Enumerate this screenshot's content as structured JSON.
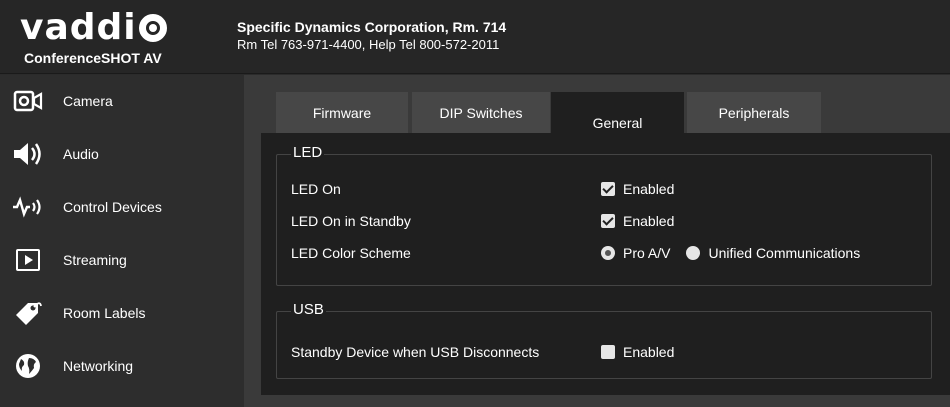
{
  "header": {
    "brand": "vaddi",
    "brand_o": "o",
    "product": "ConferenceSHOT AV",
    "org_name": "Specific Dynamics Corporation, Rm. 714",
    "org_tel": "Rm Tel 763-971-4400, Help Tel 800-572-2011"
  },
  "sidebar": {
    "items": [
      {
        "label": "Camera",
        "icon": "camera-icon"
      },
      {
        "label": "Audio",
        "icon": "speaker-icon"
      },
      {
        "label": "Control Devices",
        "icon": "control-devices-icon"
      },
      {
        "label": "Streaming",
        "icon": "play-icon"
      },
      {
        "label": "Room Labels",
        "icon": "tag-icon"
      },
      {
        "label": "Networking",
        "icon": "globe-icon"
      }
    ]
  },
  "tabs": [
    {
      "label": "Firmware",
      "active": false
    },
    {
      "label": "DIP Switches",
      "active": false
    },
    {
      "label": "General",
      "active": true
    },
    {
      "label": "Peripherals",
      "active": false
    }
  ],
  "led": {
    "title": "LED",
    "rows": [
      {
        "label": "LED On",
        "value": "Enabled",
        "checked": true
      },
      {
        "label": "LED On in Standby",
        "value": "Enabled",
        "checked": true
      }
    ],
    "color_scheme_label": "LED Color Scheme",
    "color_scheme_options": [
      {
        "label": "Pro A/V",
        "selected": true
      },
      {
        "label": "Unified Communications",
        "selected": false
      }
    ]
  },
  "usb": {
    "title": "USB",
    "rows": [
      {
        "label": "Standby Device when USB Disconnects",
        "value": "Enabled",
        "checked": false
      }
    ]
  }
}
